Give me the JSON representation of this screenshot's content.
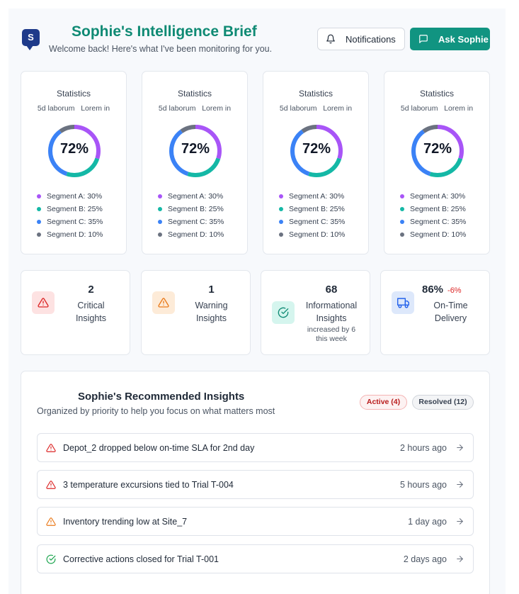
{
  "header": {
    "logo_letter": "S",
    "title": "Sophie's Intelligence Brief",
    "subtitle": "Welcome back! Here's what I've been monitoring for you.",
    "notifications_label": "Notifications",
    "ask_label": "Ask Sophie"
  },
  "donut_cards": [
    {
      "title": "Statistics",
      "subtitle": "5d laborum   Lorem in",
      "percent": "72%"
    },
    {
      "title": "Statistics",
      "subtitle": "5d laborum   Lorem in",
      "percent": "72%"
    },
    {
      "title": "Statistics",
      "subtitle": "5d laborum   Lorem in",
      "percent": "72%"
    },
    {
      "title": "Statistics",
      "subtitle": "5d laborum   Lorem in",
      "percent": "72%"
    }
  ],
  "segments": [
    {
      "label": "Segment A: 30%",
      "value": 30,
      "color": "#a855f7"
    },
    {
      "label": "Segment B: 25%",
      "value": 25,
      "color": "#14b8a6"
    },
    {
      "label": "Segment C: 35%",
      "value": 35,
      "color": "#3b82f6"
    },
    {
      "label": "Segment D: 10%",
      "value": 10,
      "color": "#6b7280"
    }
  ],
  "stats": {
    "critical": {
      "value": "2",
      "label_1": "Critical",
      "label_2": "Insights",
      "icon": "alert-triangle-icon"
    },
    "warning": {
      "value": "1",
      "label_1": "Warning",
      "label_2": "Insights",
      "icon": "alert-triangle-icon"
    },
    "informational": {
      "value": "68",
      "label_1": "Informational",
      "label_2": "Insights",
      "note_1": "increased by 6",
      "note_2": "this week",
      "icon": "check-circle-icon"
    },
    "delivery": {
      "value": "86%",
      "delta": "-6%",
      "label_1": "On-Time",
      "label_2": "Delivery",
      "icon": "truck-icon"
    }
  },
  "insights": {
    "title": "Sophie's Recommended Insights",
    "subtitle": "Organized by priority to help you focus on what matters most",
    "active_label": "Active (4)",
    "resolved_label": "Resolved (12)",
    "items": [
      {
        "text": "Depot_2 dropped below on-time SLA for 2nd day",
        "time": "2 hours ago",
        "severity": "critical"
      },
      {
        "text": "3 temperature excursions tied to Trial T-004",
        "time": "5 hours ago",
        "severity": "critical"
      },
      {
        "text": "Inventory trending low at Site_7",
        "time": "1 day ago",
        "severity": "warning"
      },
      {
        "text": "Corrective actions closed for Trial T-001",
        "time": "2 days ago",
        "severity": "resolved"
      }
    ]
  },
  "colors": {
    "brand": "#0f8a74",
    "button": "#119481",
    "critical": "#dc2626",
    "warning": "#ea7a1a",
    "success": "#16a34a",
    "info_blue": "#2563eb"
  }
}
